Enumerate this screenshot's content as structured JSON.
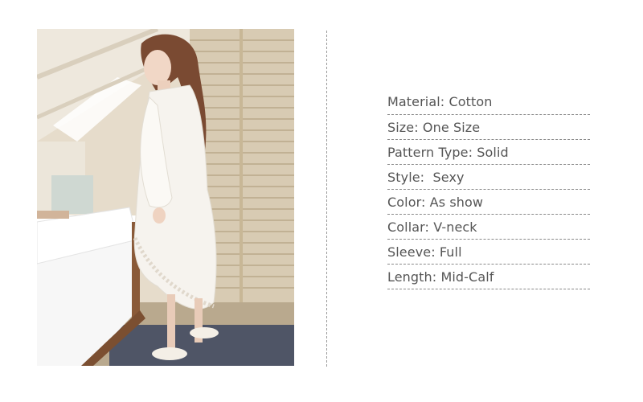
{
  "specs": [
    "Material: Cotton",
    "Size: One Size",
    "Pattern Type: Solid",
    "Style:  Sexy",
    "Color: As show",
    "Collar: V-neck",
    "Sleeve: Full",
    "Length: Mid-Calf"
  ],
  "colors": {
    "text": "#555555",
    "divider": "#9a9a9a",
    "dress": "#f6f3ee"
  }
}
